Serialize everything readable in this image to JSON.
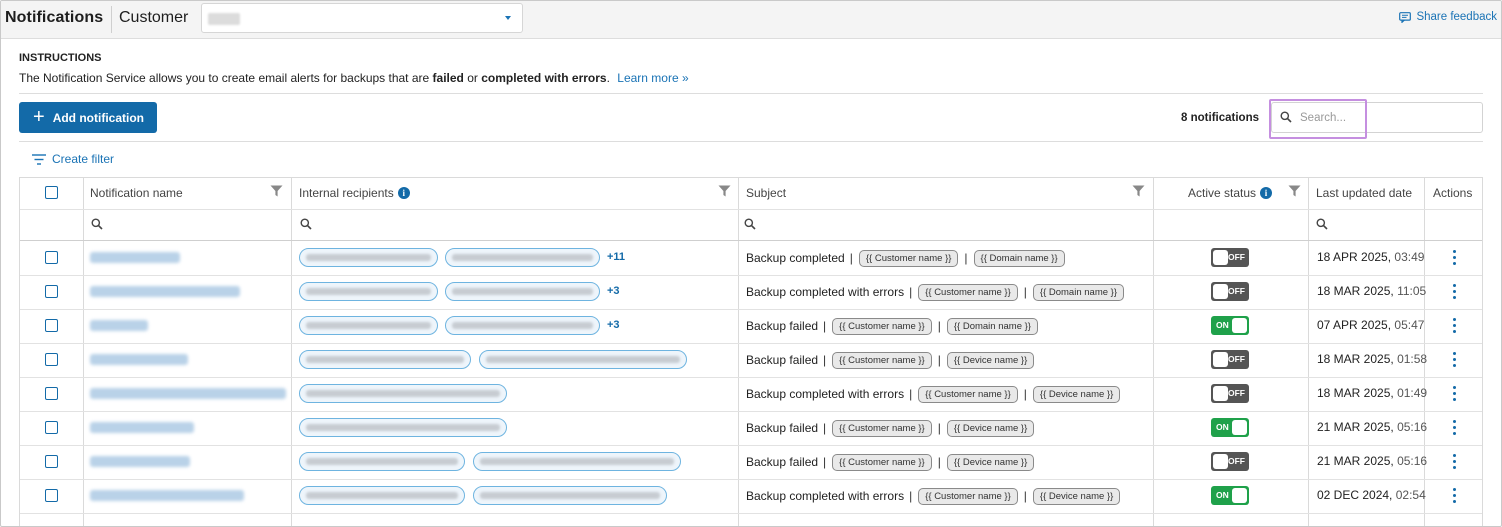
{
  "header": {
    "title": "Notifications",
    "customer_label": "Customer",
    "customer_value": "",
    "feedback_label": "Share feedback"
  },
  "instructions": {
    "heading": "INSTRUCTIONS",
    "text_before": "The Notification Service allows you to create email alerts for backups that are ",
    "failed": "failed",
    "text_or": " or ",
    "completed_with_errors": "completed with errors",
    "text_period": ".",
    "learn_more": "Learn more »"
  },
  "toolbar": {
    "add_label": "Add notification",
    "count_label": "8 notifications",
    "search_placeholder": "Search...",
    "create_filter": "Create filter"
  },
  "table": {
    "columns": {
      "name": "Notification name",
      "recipients": "Internal recipients",
      "subject": "Subject",
      "status": "Active status",
      "updated": "Last updated date",
      "actions": "Actions"
    },
    "rows": [
      {
        "subject": "Backup completed",
        "tag1": "{{ Customer name }}",
        "tag2": "{{ Domain name }}",
        "extra": "+11",
        "status": "OFF",
        "date": "18 APR 2025,",
        "time": "03:49"
      },
      {
        "subject": "Backup completed with errors",
        "tag1": "{{ Customer name }}",
        "tag2": "{{ Domain name }}",
        "extra": "+3",
        "status": "OFF",
        "date": "18 MAR 2025,",
        "time": "11:05"
      },
      {
        "subject": "Backup failed",
        "tag1": "{{ Customer name }}",
        "tag2": "{{ Domain name }}",
        "extra": "+3",
        "status": "ON",
        "date": "07 APR 2025,",
        "time": "05:47"
      },
      {
        "subject": "Backup failed",
        "tag1": "{{ Customer name }}",
        "tag2": "{{ Device name }}",
        "extra": "",
        "status": "OFF",
        "date": "18 MAR 2025,",
        "time": "01:58"
      },
      {
        "subject": "Backup completed with errors",
        "tag1": "{{ Customer name }}",
        "tag2": "{{ Device name }}",
        "extra": "",
        "status": "OFF",
        "date": "18 MAR 2025,",
        "time": "01:49"
      },
      {
        "subject": "Backup failed",
        "tag1": "{{ Customer name }}",
        "tag2": "{{ Device name }}",
        "extra": "",
        "status": "ON",
        "date": "21 MAR 2025,",
        "time": "05:16"
      },
      {
        "subject": "Backup failed",
        "tag1": "{{ Customer name }}",
        "tag2": "{{ Device name }}",
        "extra": "",
        "status": "OFF",
        "date": "21 MAR 2025,",
        "time": "05:16"
      },
      {
        "subject": "Backup completed with errors",
        "tag1": "{{ Customer name }}",
        "tag2": "{{ Device name }}",
        "extra": "",
        "status": "ON",
        "date": "02 DEC 2024,",
        "time": "02:54"
      }
    ]
  },
  "colors": {
    "primary": "#136aa8",
    "toggle_on": "#1fa14a",
    "toggle_off": "#555555",
    "highlight": "#c58fe0"
  }
}
